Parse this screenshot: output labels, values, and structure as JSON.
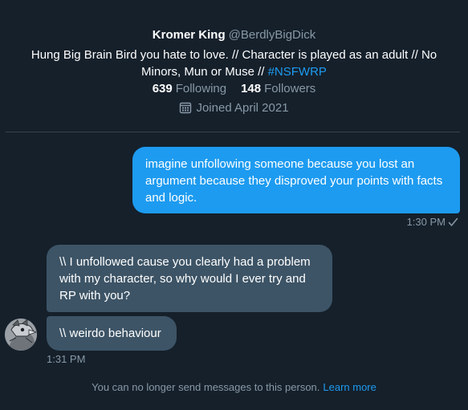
{
  "profile": {
    "display_name": "Kromer King",
    "handle": "@BerdlyBigDick",
    "bio_text": "Hung Big Brain Bird you hate to love. // Character is played as an adult // No Minors, Mun or Muse // ",
    "bio_hashtag": "#NSFWRP",
    "following_count": "639",
    "following_label": "Following",
    "followers_count": "148",
    "followers_label": "Followers",
    "joined": "Joined April 2021",
    "joined_icon": "calendar-icon"
  },
  "messages": [
    {
      "direction": "outgoing",
      "text": "imagine unfollowing someone because you lost an argument because they disproved your points with facts and logic.",
      "time": "1:30 PM",
      "status_icon": "checkmark-icon"
    },
    {
      "direction": "incoming",
      "text": "\\\\ I unfollowed cause you clearly had a problem with my character, so why would I ever try and RP with you?"
    },
    {
      "direction": "incoming",
      "text": "\\\\ weirdo behaviour",
      "time": "1:31 PM"
    }
  ],
  "footer": {
    "notice": "You can no longer send messages to this person.",
    "link": "Learn more"
  },
  "colors": {
    "background": "#15202b",
    "accent": "#1d9bf0",
    "incoming_bubble": "#3d5466",
    "muted_text": "#8899a6"
  }
}
